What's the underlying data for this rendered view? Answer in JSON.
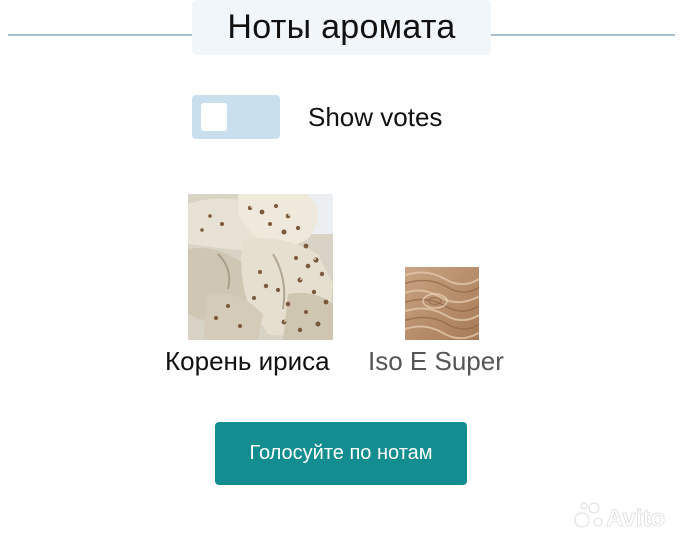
{
  "header": {
    "title": "Ноты аромата"
  },
  "toggle": {
    "label": "Show votes",
    "checked": false
  },
  "notes": [
    {
      "label": "Корень ириса",
      "image_icon": "orris-root-image"
    },
    {
      "label": "Iso E Super",
      "image_icon": "wood-grain-image"
    }
  ],
  "vote_button": {
    "label": "Голосуйте по нотам"
  },
  "watermark": {
    "text": "Avito"
  },
  "colors": {
    "accent": "#138d90",
    "toggle_bg": "#c9dfee",
    "header_bg": "#f1f6fb",
    "rule": "#a9bccd"
  }
}
